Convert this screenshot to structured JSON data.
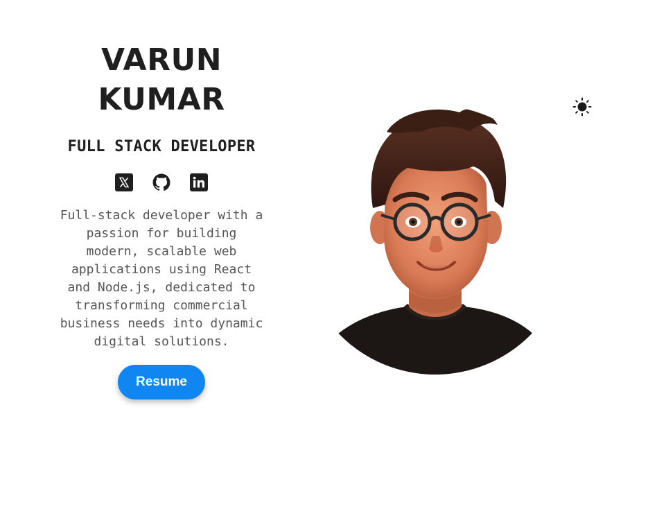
{
  "hero": {
    "name_line1": "VARUN",
    "name_line2": "KUMAR",
    "role": "FULL STACK DEVELOPER",
    "bio": "Full-stack developer with a passion for building modern, scalable web applications using React and Node.js, dedicated to transforming commercial business needs into dynamic digital solutions.",
    "resume_label": "Resume"
  },
  "socials": [
    {
      "icon": "x-twitter-icon"
    },
    {
      "icon": "github-icon"
    },
    {
      "icon": "linkedin-icon"
    }
  ],
  "theme_toggle": {
    "icon": "sun-icon"
  },
  "avatar": {
    "description_icon": "cartoon-avatar-illustration"
  },
  "colors": {
    "accent": "#0f86f2",
    "text_dark": "#1f1f1f",
    "text_muted": "#555555",
    "background": "#ffffff"
  }
}
